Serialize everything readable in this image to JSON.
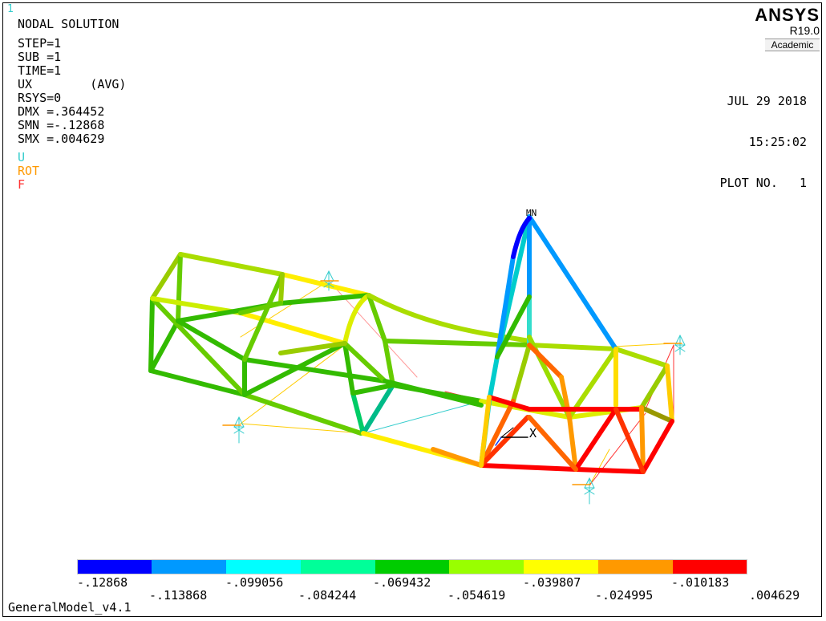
{
  "window_number": "1",
  "header": {
    "title": "NODAL SOLUTION",
    "lines": [
      "STEP=1",
      "SUB =1",
      "TIME=1",
      "UX        (AVG)",
      "RSYS=0",
      "DMX =.364452",
      "SMN =-.12868",
      "SMX =.004629"
    ]
  },
  "symbols": {
    "u": {
      "label": "U",
      "color": "#33cccc"
    },
    "rot": {
      "label": "ROT",
      "color": "#ff9900"
    },
    "f": {
      "label": "F",
      "color": "#ff3333"
    }
  },
  "brand": {
    "logo": "ANSYS",
    "version": "R19.0",
    "edition": "Academic"
  },
  "plot_info": {
    "date": "JUL 29 2018",
    "time": "15:25:02",
    "plot_no": "PLOT NO.   1"
  },
  "model_name": "GeneralModel_v4.1",
  "markers": {
    "min": "MN",
    "axis_x": "X"
  },
  "contour": {
    "colors": [
      "#0000ff",
      "#0099ff",
      "#00ffff",
      "#00ff99",
      "#00cc00",
      "#99ff00",
      "#ffff00",
      "#ff9900",
      "#ff0000"
    ],
    "labels": [
      ".12868",
      "-.113868",
      "-.099056",
      "-.084244",
      "-.069432",
      "-.054619",
      "-.039807",
      "-.024995",
      "-.010183",
      ".004629"
    ],
    "label_first_prefix": "-"
  }
}
